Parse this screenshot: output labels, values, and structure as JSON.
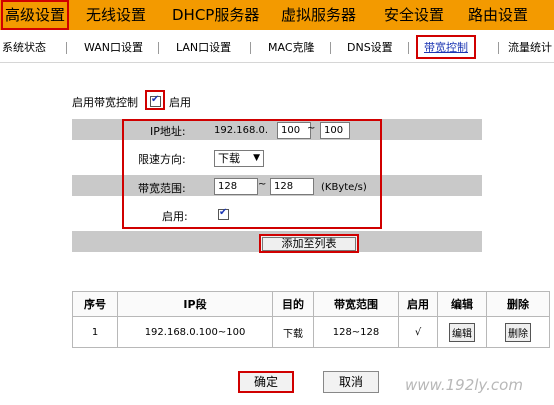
{
  "top_nav": {
    "tabs": [
      {
        "label": "高级设置",
        "active": true
      },
      {
        "label": "无线设置"
      },
      {
        "label": "DHCP服务器"
      },
      {
        "label": "虚拟服务器"
      },
      {
        "label": "安全设置"
      },
      {
        "label": "路由设置"
      }
    ]
  },
  "sub_nav": {
    "items": [
      {
        "label": "系统状态"
      },
      {
        "label": "WAN口设置"
      },
      {
        "label": "LAN口设置"
      },
      {
        "label": "MAC克隆"
      },
      {
        "label": "DNS设置"
      },
      {
        "label": "带宽控制",
        "active": true
      },
      {
        "label": "流量统计"
      }
    ]
  },
  "bandwidth": {
    "enable_label": "启用带宽控制",
    "enable_suffix": "启用",
    "enable_checked": true
  },
  "form": {
    "ip_label": "IP地址:",
    "ip_prefix": "192.168.0.",
    "ip_start": "100",
    "ip_tilde": "~",
    "ip_end": "100",
    "direction_label": "限速方向:",
    "direction_value": "下载",
    "range_label": "带宽范围:",
    "range_min": "128",
    "range_tilde": "~",
    "range_max": "128",
    "range_unit": "(KByte/s)",
    "enabled_label": "启用:",
    "enabled_checked": true
  },
  "add_button": "添加至列表",
  "table": {
    "headers": [
      "序号",
      "IP段",
      "目的",
      "带宽范围",
      "启用",
      "编辑",
      "删除"
    ],
    "rows": [
      {
        "index": "1",
        "ip": "192.168.0.100~100",
        "target": "下载",
        "range": "128~128",
        "enabled": "√",
        "edit": "编辑",
        "delete": "删除"
      }
    ]
  },
  "buttons": {
    "ok": "确定",
    "cancel": "取消"
  },
  "watermark": "www.192ly.com",
  "colors": {
    "nav_orange": "#f39a00",
    "highlight_red": "#d00000",
    "row_band": "#c9c9c9",
    "link_blue": "#1c36b3"
  }
}
